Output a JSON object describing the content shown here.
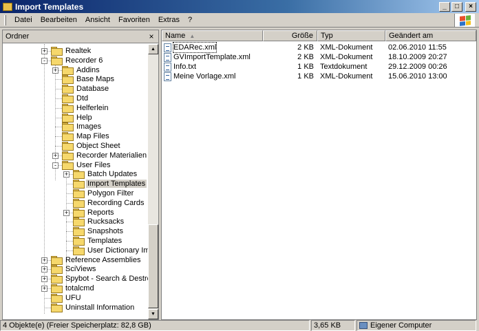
{
  "window": {
    "title": "Import Templates",
    "minimize_label": "_",
    "maximize_label": "□",
    "close_label": "×"
  },
  "menubar": {
    "items": [
      "Datei",
      "Bearbeiten",
      "Ansicht",
      "Favoriten",
      "Extras",
      "?"
    ]
  },
  "folder_pane": {
    "header": "Ordner",
    "close_label": "×",
    "tree": [
      {
        "label": "Realtek",
        "level": 0,
        "expander": "+"
      },
      {
        "label": "Recorder 6",
        "level": 0,
        "expander": "-"
      },
      {
        "label": "Addins",
        "level": 1,
        "expander": "+"
      },
      {
        "label": "Base Maps",
        "level": 1,
        "expander": ""
      },
      {
        "label": "Database",
        "level": 1,
        "expander": ""
      },
      {
        "label": "Dtd",
        "level": 1,
        "expander": ""
      },
      {
        "label": "Helferlein",
        "level": 1,
        "expander": ""
      },
      {
        "label": "Help",
        "level": 1,
        "expander": ""
      },
      {
        "label": "Images",
        "level": 1,
        "expander": ""
      },
      {
        "label": "Map Files",
        "level": 1,
        "expander": ""
      },
      {
        "label": "Object Sheet",
        "level": 1,
        "expander": ""
      },
      {
        "label": "Recorder Materialien",
        "level": 1,
        "expander": "+"
      },
      {
        "label": "User Files",
        "level": 1,
        "expander": "-"
      },
      {
        "label": "Batch Updates",
        "level": 2,
        "expander": "+"
      },
      {
        "label": "Import Templates",
        "level": 2,
        "expander": "",
        "selected": true
      },
      {
        "label": "Polygon Filter",
        "level": 2,
        "expander": ""
      },
      {
        "label": "Recording Cards",
        "level": 2,
        "expander": ""
      },
      {
        "label": "Reports",
        "level": 2,
        "expander": "+"
      },
      {
        "label": "Rucksacks",
        "level": 2,
        "expander": ""
      },
      {
        "label": "Snapshots",
        "level": 2,
        "expander": ""
      },
      {
        "label": "Templates",
        "level": 2,
        "expander": ""
      },
      {
        "label": "User Dictionary Images",
        "level": 2,
        "expander": ""
      },
      {
        "label": "Reference Assemblies",
        "level": 0,
        "expander": "+"
      },
      {
        "label": "SciViews",
        "level": 0,
        "expander": "+"
      },
      {
        "label": "Spybot - Search & Destroy",
        "level": 0,
        "expander": "+"
      },
      {
        "label": "totalcmd",
        "level": 0,
        "expander": "+"
      },
      {
        "label": "UFU",
        "level": 0,
        "expander": ""
      },
      {
        "label": "Uninstall Information",
        "level": 0,
        "expander": ""
      }
    ]
  },
  "file_list": {
    "columns": {
      "name": "Name",
      "size": "Größe",
      "type": "Typ",
      "date": "Geändert am"
    },
    "sort_indicator": "▲",
    "rows": [
      {
        "name": "EDARec.xml",
        "size": "2 KB",
        "type": "XML-Dokument",
        "date": "02.06.2010 11:55",
        "focused": true
      },
      {
        "name": "GVImportTemplate.xml",
        "size": "2 KB",
        "type": "XML-Dokument",
        "date": "18.10.2009 20:27"
      },
      {
        "name": "Info.txt",
        "size": "1 KB",
        "type": "Textdokument",
        "date": "29.12.2009 00:26"
      },
      {
        "name": "Meine Vorlage.xml",
        "size": "1 KB",
        "type": "XML-Dokument",
        "date": "15.06.2010 13:00"
      }
    ]
  },
  "statusbar": {
    "objects": "4 Objekte(e) (Freier Speicherplatz: 82,8 GB)",
    "size": "3,65 KB",
    "location": "Eigener Computer"
  }
}
